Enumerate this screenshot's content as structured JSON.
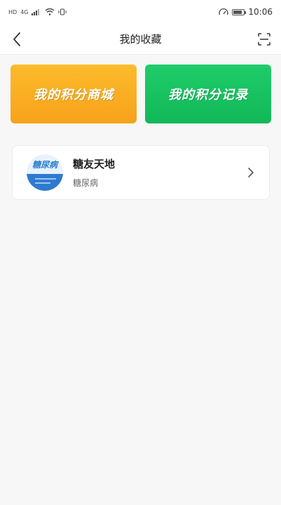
{
  "status_bar": {
    "left_labels": [
      "HD",
      "4G"
    ],
    "time": "10:06"
  },
  "header": {
    "title": "我的收藏"
  },
  "promos": [
    {
      "label": "我的积分商城",
      "color": "#f9ab22"
    },
    {
      "label": "我的积分记录",
      "color": "#17bf5f"
    }
  ],
  "favorites": [
    {
      "thumb_text": "糖尿病",
      "title": "糖友天地",
      "subtitle": "糖尿病"
    }
  ]
}
